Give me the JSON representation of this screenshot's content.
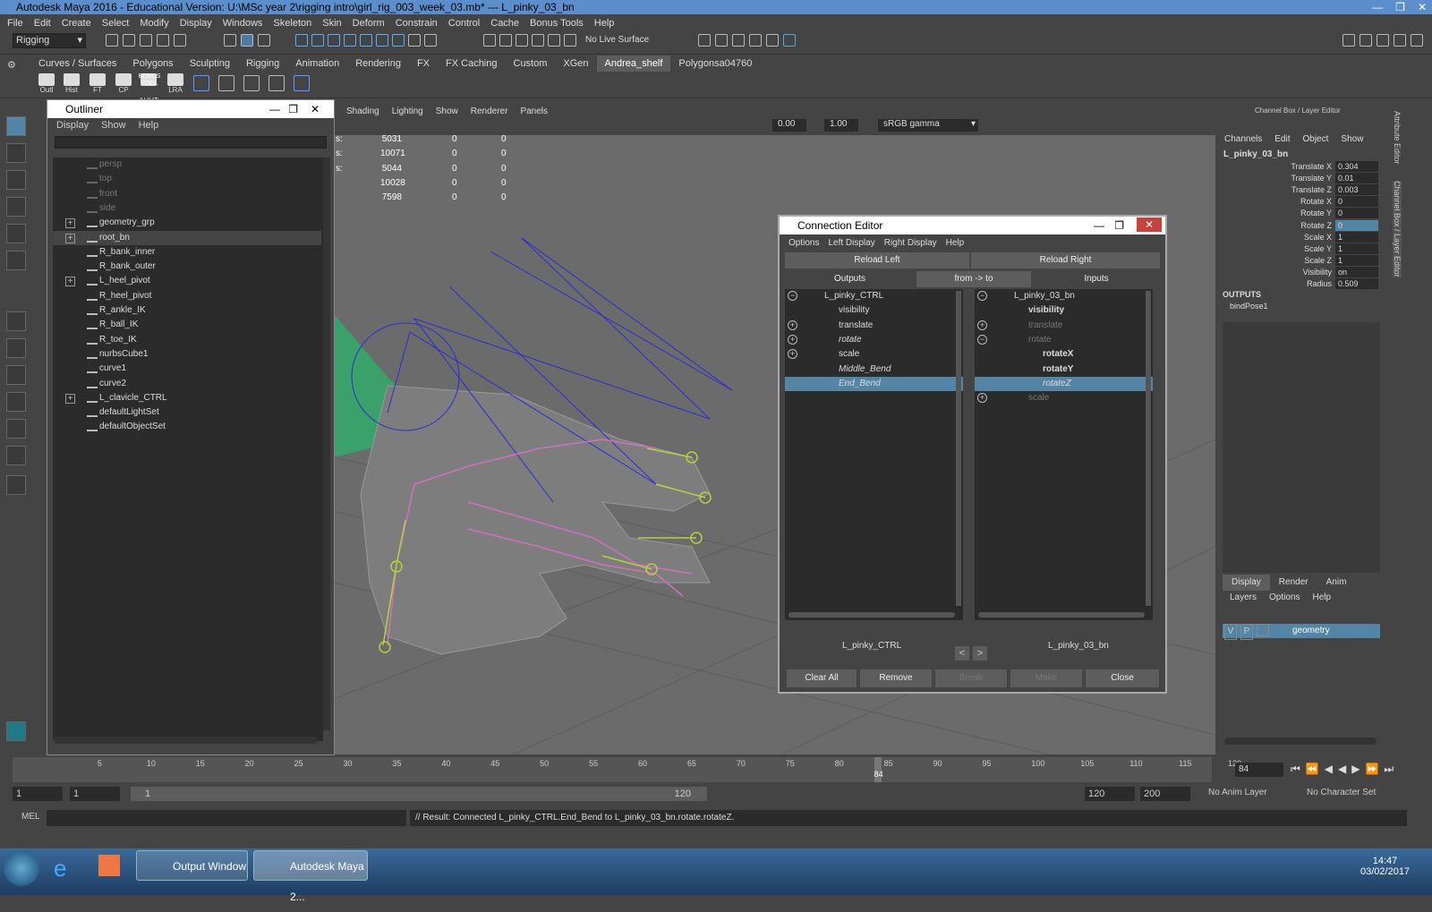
{
  "app": {
    "title": "Autodesk Maya 2016 - Educational Version: U:\\MSc year 2\\rigging intro\\girl_rig_003_week_03.mb*   ---   L_pinky_03_bn"
  },
  "menubar": [
    "File",
    "Edit",
    "Create",
    "Select",
    "Modify",
    "Display",
    "Windows",
    "Skeleton",
    "Skin",
    "Deform",
    "Constrain",
    "Control",
    "Cache",
    "Bonus Tools",
    "Help"
  ],
  "status": {
    "mode": "Rigging",
    "live_surface": "No Live Surface"
  },
  "shelf_tabs": [
    "Curves / Surfaces",
    "Polygons",
    "Sculpting",
    "Rigging",
    "Animation",
    "Rendering",
    "FX",
    "FX Caching",
    "Custom",
    "XGen",
    "Andrea_shelf",
    "Polygonsa04760"
  ],
  "shelf_active": "Andrea_shelf",
  "shelf_icons": [
    "Outl",
    "Hist",
    "FT",
    "CP",
    "AUUT",
    "LRA"
  ],
  "shelf_bonus": "BONUS TOOL",
  "viewport": {
    "menu": [
      "Shading",
      "Lighting",
      "Show",
      "Renderer",
      "Panels"
    ],
    "value_a": "0.00",
    "value_b": "1.00",
    "color_space": "sRGB gamma",
    "stats": [
      {
        "label": "s:",
        "a": "5031",
        "b": "0",
        "c": "0"
      },
      {
        "label": "s:",
        "a": "10071",
        "b": "0",
        "c": "0"
      },
      {
        "label": "s:",
        "a": "5044",
        "b": "0",
        "c": "0"
      },
      {
        "label": "",
        "a": "10028",
        "b": "0",
        "c": "0"
      },
      {
        "label": "",
        "a": "7598",
        "b": "0",
        "c": "0"
      }
    ]
  },
  "outliner": {
    "title": "Outliner",
    "menu": [
      "Display",
      "Show",
      "Help"
    ],
    "items": [
      {
        "label": "persp",
        "dim": true,
        "exp": false,
        "icon": "camera-icon"
      },
      {
        "label": "top",
        "dim": true,
        "exp": false,
        "icon": "camera-icon"
      },
      {
        "label": "front",
        "dim": true,
        "exp": false,
        "icon": "camera-icon"
      },
      {
        "label": "side",
        "dim": true,
        "exp": false,
        "icon": "camera-icon"
      },
      {
        "label": "geometry_grp",
        "dim": false,
        "exp": true,
        "icon": "group-icon"
      },
      {
        "label": "root_bn",
        "dim": false,
        "exp": true,
        "icon": "joint-icon",
        "selected": true
      },
      {
        "label": "R_bank_inner",
        "dim": false,
        "exp": false,
        "icon": "locator-icon"
      },
      {
        "label": "R_bank_outer",
        "dim": false,
        "exp": false,
        "icon": "locator-icon"
      },
      {
        "label": "L_heel_pivot",
        "dim": false,
        "exp": true,
        "icon": "locator-icon"
      },
      {
        "label": "R_heel_pivot",
        "dim": false,
        "exp": false,
        "icon": "locator-icon"
      },
      {
        "label": "R_ankle_IK",
        "dim": false,
        "exp": false,
        "icon": "ik-handle-icon"
      },
      {
        "label": "R_ball_IK",
        "dim": false,
        "exp": false,
        "icon": "ik-handle-icon"
      },
      {
        "label": "R_toe_IK",
        "dim": false,
        "exp": false,
        "icon": "ik-handle-icon"
      },
      {
        "label": "nurbsCube1",
        "dim": false,
        "exp": false,
        "icon": "group-icon"
      },
      {
        "label": "curve1",
        "dim": false,
        "exp": false,
        "icon": "curve-icon"
      },
      {
        "label": "curve2",
        "dim": false,
        "exp": false,
        "icon": "curve-icon"
      },
      {
        "label": "L_clavicle_CTRL",
        "dim": false,
        "exp": true,
        "icon": "curve-icon"
      },
      {
        "label": "defaultLightSet",
        "dim": false,
        "exp": false,
        "icon": "set-icon"
      },
      {
        "label": "defaultObjectSet",
        "dim": false,
        "exp": false,
        "icon": "set-icon"
      }
    ]
  },
  "connection_editor": {
    "title": "Connection Editor",
    "menu": [
      "Options",
      "Left Display",
      "Right Display",
      "Help"
    ],
    "reload_left": "Reload Left",
    "reload_right": "Reload Right",
    "outputs": "Outputs",
    "direction": "from -> to",
    "inputs": "Inputs",
    "left": [
      {
        "label": "L_pinky_CTRL",
        "indent": 44,
        "pm": "−"
      },
      {
        "label": "visibility",
        "indent": 60,
        "pm": ""
      },
      {
        "label": "translate",
        "indent": 60,
        "pm": "+"
      },
      {
        "label": "rotate",
        "indent": 60,
        "pm": "+",
        "style": "it"
      },
      {
        "label": "scale",
        "indent": 60,
        "pm": "+"
      },
      {
        "label": "Middle_Bend",
        "indent": 60,
        "pm": "",
        "style": "it"
      },
      {
        "label": "End_Bend",
        "indent": 60,
        "pm": "",
        "style": "it",
        "selected": true
      }
    ],
    "right": [
      {
        "label": "L_pinky_03_bn",
        "indent": 44,
        "pm": "−"
      },
      {
        "label": "visibility",
        "indent": 60,
        "pm": "",
        "style": "bold"
      },
      {
        "label": "translate",
        "indent": 60,
        "pm": "+",
        "style": "dim"
      },
      {
        "label": "rotate",
        "indent": 60,
        "pm": "−",
        "style": "dim"
      },
      {
        "label": "rotateX",
        "indent": 76,
        "pm": "",
        "style": "bold"
      },
      {
        "label": "rotateY",
        "indent": 76,
        "pm": "",
        "style": "bold"
      },
      {
        "label": "rotateZ",
        "indent": 76,
        "pm": "",
        "style": "it",
        "selected": true
      },
      {
        "label": "scale",
        "indent": 60,
        "pm": "+",
        "style": "dim"
      }
    ],
    "left_node": "L_pinky_CTRL",
    "right_node": "L_pinky_03_bn",
    "prev": "<",
    "next": ">",
    "buttons": {
      "clear_all": "Clear All",
      "remove": "Remove",
      "break": "Break",
      "make": "Make",
      "close": "Close"
    }
  },
  "channel_box": {
    "title": "Channel Box / Layer Editor",
    "menu": [
      "Channels",
      "Edit",
      "Object",
      "Show"
    ],
    "node": "L_pinky_03_bn",
    "attrs": [
      {
        "name": "Translate X",
        "value": "0.304"
      },
      {
        "name": "Translate Y",
        "value": "0.01"
      },
      {
        "name": "Translate Z",
        "value": "0.003"
      },
      {
        "name": "Rotate X",
        "value": "0"
      },
      {
        "name": "Rotate Y",
        "value": "0"
      },
      {
        "name": "Rotate Z",
        "value": "0",
        "selected": true
      },
      {
        "name": "Scale X",
        "value": "1"
      },
      {
        "name": "Scale Y",
        "value": "1"
      },
      {
        "name": "Scale Z",
        "value": "1"
      },
      {
        "name": "Visibility",
        "value": "on"
      },
      {
        "name": "Radius",
        "value": "0.509"
      }
    ],
    "outputs_label": "OUTPUTS",
    "outputs_item": "bindPose1",
    "side_tabs": [
      "Attribute Editor",
      "Channel Box / Layer Editor"
    ],
    "layer_tabs": [
      "Display",
      "Render",
      "Anim"
    ],
    "layer_menu": [
      "Layers",
      "Options",
      "Help"
    ],
    "layer": {
      "v": "V",
      "p": "P",
      "name": "geometry"
    }
  },
  "timeline": {
    "ticks": [
      "5",
      "10",
      "15",
      "20",
      "25",
      "30",
      "35",
      "40",
      "45",
      "50",
      "55",
      "60",
      "65",
      "70",
      "75",
      "80",
      "85",
      "90",
      "95",
      "100",
      "105",
      "110",
      "115",
      "120"
    ],
    "current": "84",
    "current_field": "84"
  },
  "range": {
    "start": "1",
    "start2": "1",
    "slider_start": "1",
    "slider_end": "120",
    "end": "120",
    "end2": "200",
    "anim_layer": "No Anim Layer",
    "char_set": "No Character Set"
  },
  "cmd": {
    "label": "MEL",
    "result": "// Result: Connected L_pinky_CTRL.End_Bend to L_pinky_03_bn.rotate.rotateZ."
  },
  "taskbar": {
    "items": [
      "Output Window",
      "Autodesk Maya 2..."
    ],
    "time": "14:47",
    "date": "03/02/2017"
  }
}
